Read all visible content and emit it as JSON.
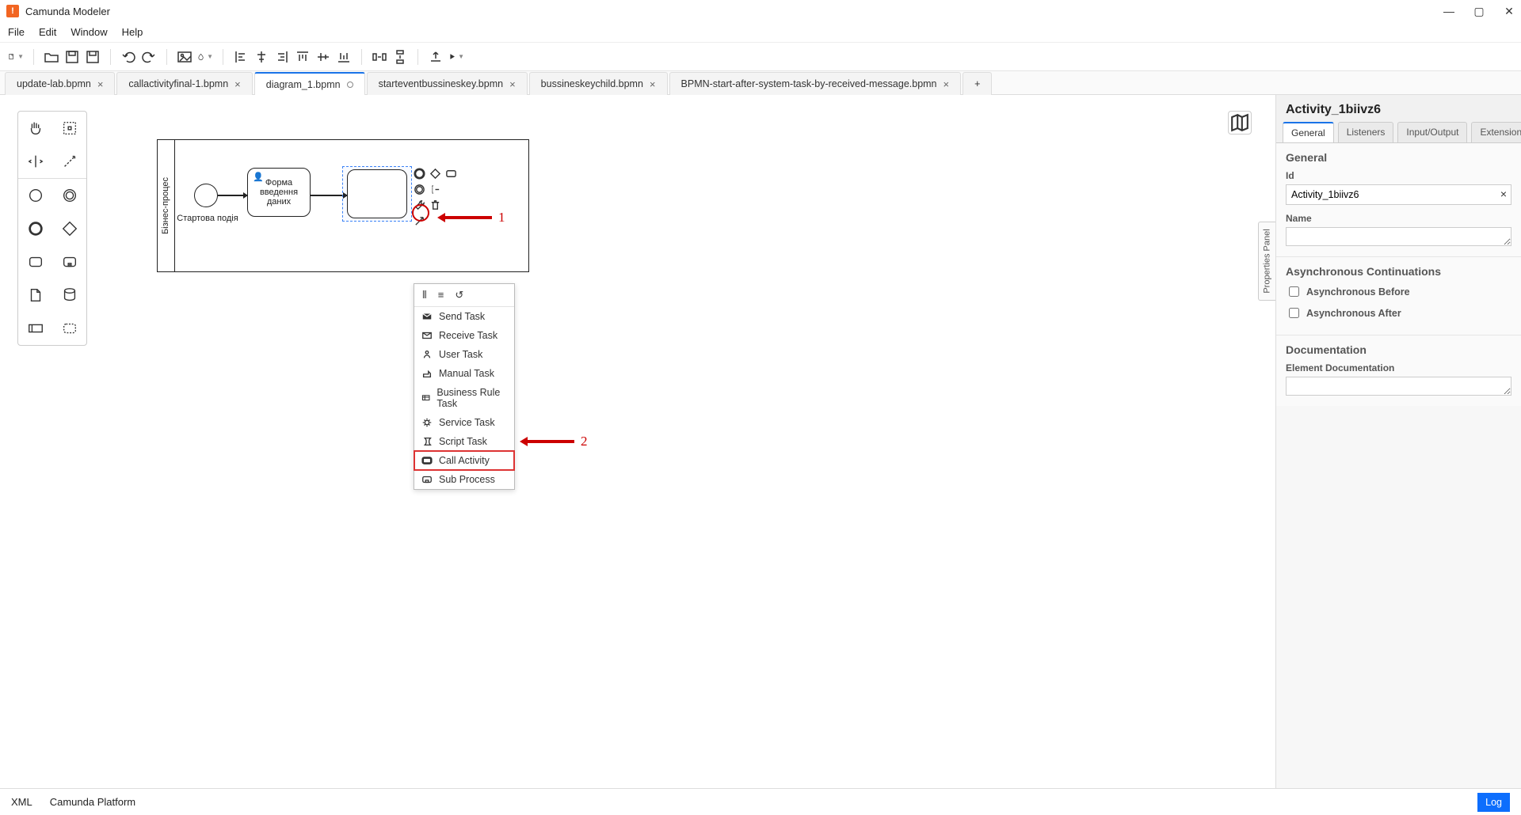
{
  "app": {
    "title": "Camunda Modeler"
  },
  "menubar": [
    "File",
    "Edit",
    "Window",
    "Help"
  ],
  "tabs": [
    {
      "label": "update-lab.bpmn",
      "closable": true
    },
    {
      "label": "callactivityfinal-1.bpmn",
      "closable": true
    },
    {
      "label": "diagram_1.bpmn",
      "active": true,
      "dirty": true
    },
    {
      "label": "starteventbussineskey.bpmn",
      "closable": true
    },
    {
      "label": "bussineskeychild.bpmn",
      "closable": true
    },
    {
      "label": "BPMN-start-after-system-task-by-received-message.bpmn",
      "closable": true
    }
  ],
  "diagram": {
    "poolLabel": "Бізнес-процес",
    "startEventLabel": "Стартова подія",
    "task1Label": "Форма введення даних"
  },
  "contextPadHandle": "Properties Panel",
  "typeMenu": {
    "items": [
      {
        "icon": "send",
        "label": "Send Task"
      },
      {
        "icon": "receive",
        "label": "Receive Task"
      },
      {
        "icon": "user",
        "label": "User Task"
      },
      {
        "icon": "manual",
        "label": "Manual Task"
      },
      {
        "icon": "rule",
        "label": "Business Rule Task"
      },
      {
        "icon": "service",
        "label": "Service Task"
      },
      {
        "icon": "script",
        "label": "Script Task"
      },
      {
        "icon": "call",
        "label": "Call Activity",
        "highlighted": true
      },
      {
        "icon": "sub",
        "label": "Sub Process"
      }
    ]
  },
  "annotations": {
    "one": "1",
    "two": "2"
  },
  "properties": {
    "title": "Activity_1biivz6",
    "tabs": [
      "General",
      "Listeners",
      "Input/Output",
      "Extensions"
    ],
    "sections": {
      "general": {
        "heading": "General",
        "idLabel": "Id",
        "idValue": "Activity_1biivz6",
        "nameLabel": "Name",
        "nameValue": ""
      },
      "async": {
        "heading": "Asynchronous Continuations",
        "beforeLabel": "Asynchronous Before",
        "afterLabel": "Asynchronous After"
      },
      "doc": {
        "heading": "Documentation",
        "fieldLabel": "Element Documentation",
        "value": ""
      }
    }
  },
  "statusbar": {
    "xml": "XML",
    "platform": "Camunda Platform",
    "log": "Log"
  }
}
